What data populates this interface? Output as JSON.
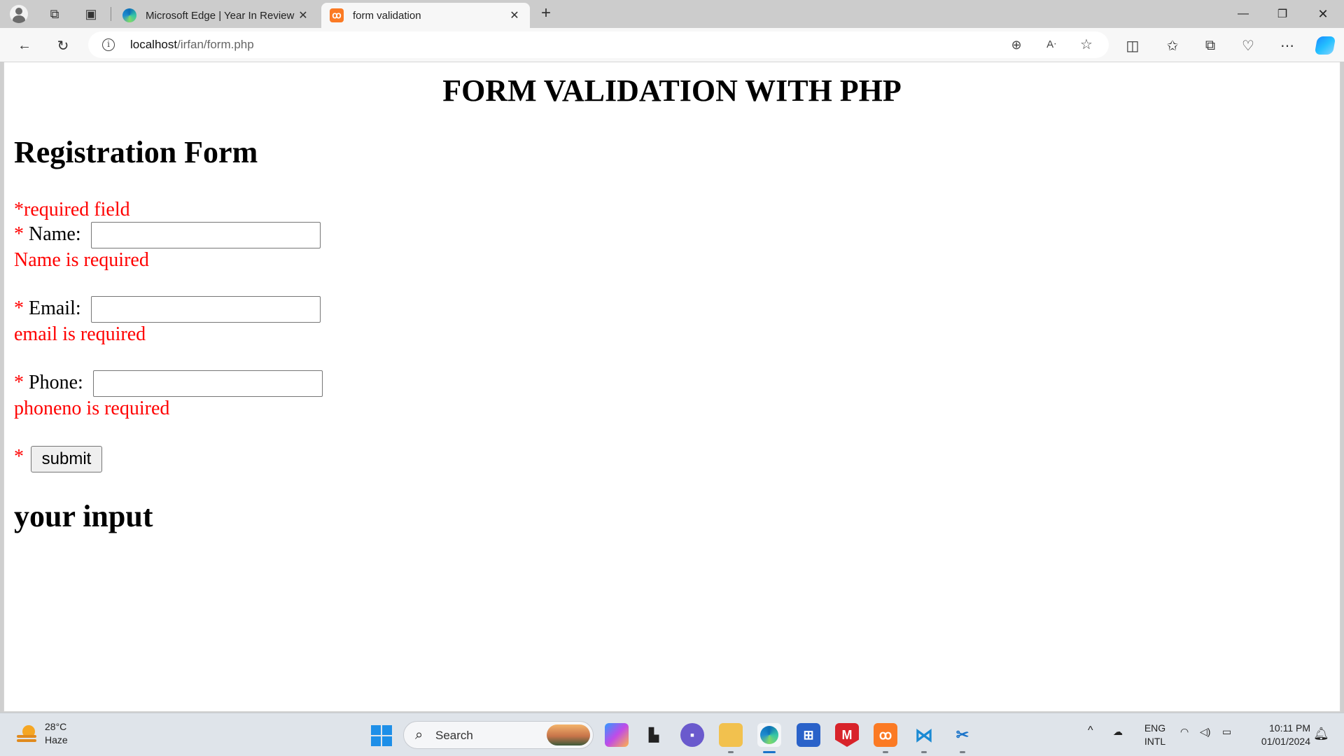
{
  "browser": {
    "tabs": [
      {
        "title": "Microsoft Edge | Year In Review",
        "active": false,
        "favicon": "edge-icon"
      },
      {
        "title": "form validation",
        "active": true,
        "favicon": "xampp-icon"
      }
    ],
    "address": {
      "host": "localhost",
      "path": "/irfan/form.php"
    }
  },
  "page": {
    "main_heading": "FORM VALIDATION WITH PHP",
    "form_heading": "Registration Form",
    "required_note": "*required field",
    "required_marker": "*",
    "fields": [
      {
        "label": "Name:",
        "value": "",
        "error": "Name is required"
      },
      {
        "label": "Email:",
        "value": "",
        "error": "email is required"
      },
      {
        "label": "Phone:",
        "value": "",
        "error": "phoneno is required"
      }
    ],
    "submit_label": "submit",
    "output_heading": "your input"
  },
  "taskbar": {
    "weather": {
      "temp": "28°C",
      "condition": "Haze"
    },
    "search_label": "Search",
    "language": {
      "line1": "ENG",
      "line2": "INTL"
    },
    "clock": {
      "time": "10:11 PM",
      "date": "01/01/2024"
    }
  },
  "colors": {
    "error": "#ff0000",
    "accent": "#1a73c9"
  }
}
